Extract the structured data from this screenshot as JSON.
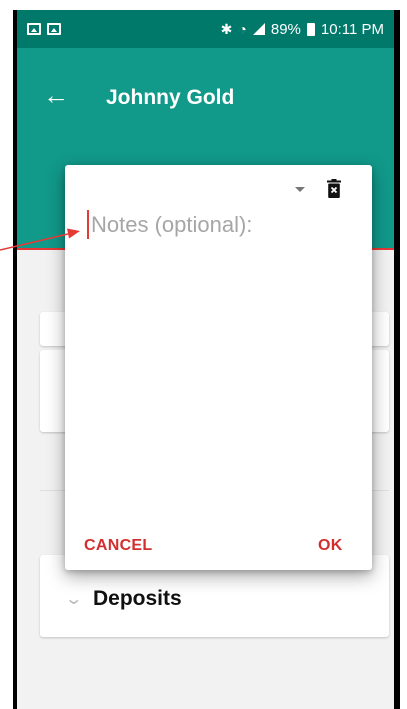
{
  "status_bar": {
    "time": "10:11 PM",
    "battery": "89%",
    "icons": [
      "gallery-icon",
      "image-icon",
      "bluetooth-icon",
      "wifi-icon",
      "signal-icon",
      "battery-icon"
    ]
  },
  "app_bar": {
    "title": "Johnny  Gold",
    "back_icon": "arrow-left-icon"
  },
  "dialog": {
    "notes_placeholder": "Notes (optional):",
    "notes_value": "",
    "cancel_label": "CANCEL",
    "ok_label": "OK",
    "icons": [
      "dropdown-triangle-icon",
      "delete-icon"
    ]
  },
  "sections": {
    "deposits_label": "Deposits"
  },
  "colors": {
    "app_bar": "#11998a",
    "status_bar": "#00796b",
    "accent": "#d32f2f",
    "annotation": "#e53935"
  }
}
